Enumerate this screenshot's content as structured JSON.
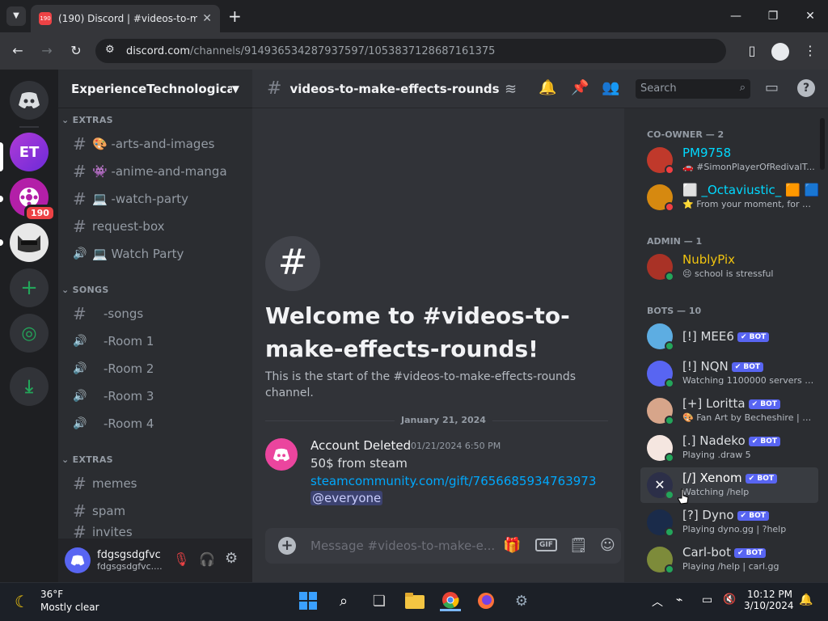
{
  "browser": {
    "tab_title": "(190) Discord | #videos-to-make...",
    "tab_badge": "190",
    "url_host": "discord.com",
    "url_path": "/channels/914936534287937597/1053837128687161375"
  },
  "guilds": {
    "server1_abbr": "ET",
    "server2_badge": "190"
  },
  "server": {
    "name": "ExperienceTechnologica...",
    "categories": [
      {
        "label": "EXTRAS"
      },
      {
        "label": "SONGS"
      },
      {
        "label": "EXTRAS"
      }
    ],
    "channels": [
      {
        "label": "🎨 -arts-and-images",
        "kind": "text"
      },
      {
        "label": "👾 -anime-and-manga",
        "kind": "text"
      },
      {
        "label": "💻 -watch-party",
        "kind": "text"
      },
      {
        "label": "request-box",
        "kind": "text"
      },
      {
        "label": "💻 Watch Party",
        "kind": "voice"
      },
      {
        "label": "-songs",
        "kind": "text"
      },
      {
        "label": "-Room 1",
        "kind": "voice"
      },
      {
        "label": "-Room 2",
        "kind": "voice"
      },
      {
        "label": "-Room 3",
        "kind": "voice"
      },
      {
        "label": "-Room 4",
        "kind": "voice"
      },
      {
        "label": "memes",
        "kind": "text"
      },
      {
        "label": "spam",
        "kind": "text"
      },
      {
        "label": "invites",
        "kind": "text"
      }
    ]
  },
  "user_panel": {
    "name": "fdgsgsdgfvc",
    "tag": "fdgsgsdgfvc...."
  },
  "channel_header": {
    "name": "videos-to-make-effects-rounds",
    "search_placeholder": "Search"
  },
  "welcome": {
    "title": "Welcome to #videos-to-make-effects-rounds!",
    "subtitle": "This is the start of the #videos-to-make-effects-rounds channel."
  },
  "divider_date": "January 21, 2024",
  "message": {
    "author": "Account Deleted",
    "timestamp": "01/21/2024 6:50 PM",
    "line1": "50$ from steam",
    "link": "steamcommunity.com/gift/7656685934763973",
    "mention": "@everyone"
  },
  "composer": {
    "placeholder": "Message #videos-to-make-e..."
  },
  "member_list": {
    "groups": [
      {
        "label": "CO-OWNER — 2"
      },
      {
        "label": "ADMIN — 1"
      },
      {
        "label": "BOTS — 10"
      }
    ],
    "members": [
      {
        "name": "PM9758",
        "status": "🚗 #SimonPlayerOfRedivalT...",
        "color": "#00d9ff",
        "bot": false
      },
      {
        "name": "⬜ _Octaviustic_ 🟧 🟦",
        "status": "⭐ From your moment, for ev...",
        "color": "#00d9ff",
        "bot": false
      },
      {
        "name": "NublyPix",
        "status": "😣 school is stressful",
        "color": "#f1c40f",
        "bot": false
      },
      {
        "name": "[!] MEE6",
        "status": "",
        "color": "#dbdee1",
        "bot": true
      },
      {
        "name": "[!] NQN",
        "status": "Watching 1100000 servers an...",
        "color": "#dbdee1",
        "bot": true
      },
      {
        "name": "[+] Loritta",
        "status": "🎨 Fan Art by Becheshire | Cl...",
        "color": "#dbdee1",
        "bot": true
      },
      {
        "name": "[.] Nadeko",
        "status": "Playing .draw 5",
        "color": "#dbdee1",
        "bot": true
      },
      {
        "name": "[/] Xenom",
        "status": "Watching /help",
        "color": "#ffffff",
        "bot": true
      },
      {
        "name": "[?] Dyno",
        "status": "Playing dyno.gg | ?help",
        "color": "#dbdee1",
        "bot": true
      },
      {
        "name": "Carl-bot",
        "status": "Playing /help | carl.gg",
        "color": "#dbdee1",
        "bot": true
      }
    ],
    "bot_label": "✔ BOT"
  },
  "taskbar": {
    "weather_temp": "36°F",
    "weather_desc": "Mostly clear",
    "time": "10:12 PM",
    "date": "3/10/2024"
  },
  "colors": {
    "blurple": "#5865f2",
    "link": "#00a8fc",
    "green": "#23a55a"
  }
}
